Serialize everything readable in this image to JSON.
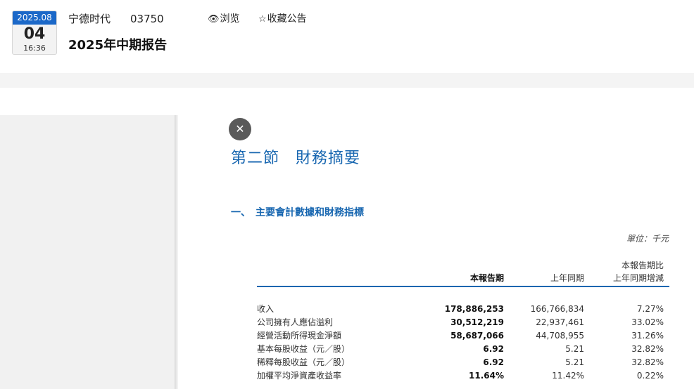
{
  "header": {
    "date_badge": {
      "month": "2025.08",
      "day": "04",
      "time": "16:36"
    },
    "company_name": "宁德时代",
    "stock_code": "03750",
    "view_label": "浏览",
    "favorite_label": "收藏公告",
    "report_title": "2025年中期报告"
  },
  "document": {
    "close_symbol": "✕",
    "section_title": "第二節　財務摘要",
    "sub_title": "一、　主要會計數據和財務指標",
    "unit": "單位：千元",
    "columns": {
      "current": "本報告期",
      "previous": "上年同期",
      "change_line1": "本報告期比",
      "change_line2": "上年同期增減"
    },
    "rows": [
      {
        "label": "收入",
        "current": "178,886,253",
        "previous": "166,766,834",
        "change": "7.27%"
      },
      {
        "label": "公司擁有人應佔溢利",
        "current": "30,512,219",
        "previous": "22,937,461",
        "change": "33.02%"
      },
      {
        "label": "經營活動所得現金淨額",
        "current": "58,687,066",
        "previous": "44,708,955",
        "change": "31.26%"
      },
      {
        "label": "基本每股收益（元／股）",
        "current": "6.92",
        "previous": "5.21",
        "change": "32.82%"
      },
      {
        "label": "稀釋每股收益（元／股）",
        "current": "6.92",
        "previous": "5.21",
        "change": "32.82%"
      },
      {
        "label": "加權平均淨資產收益率",
        "current": "11.64%",
        "previous": "11.42%",
        "change": "0.22%"
      }
    ]
  },
  "colors": {
    "accent_blue": "#1766b0",
    "badge_blue": "#1b68c8",
    "close_button": "#5a5a5a"
  }
}
